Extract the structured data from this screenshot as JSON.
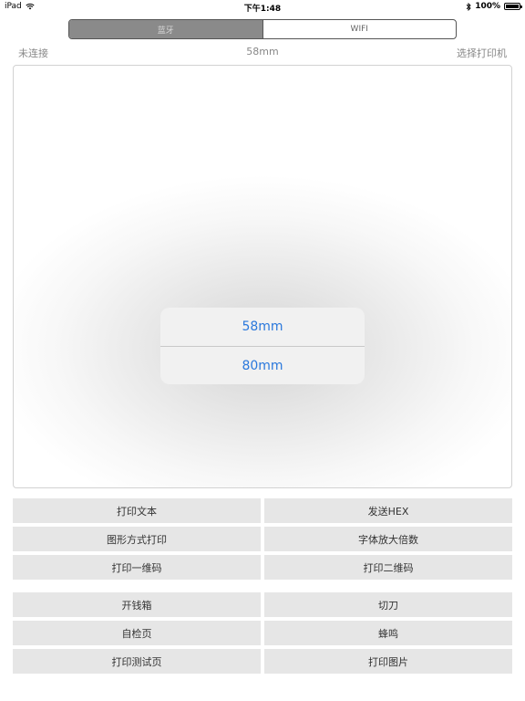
{
  "status_bar": {
    "device": "iPad",
    "time": "下午1:48",
    "battery": "100%",
    "battery_level": 1.0
  },
  "tabs": {
    "bluetooth": "蓝牙",
    "wifi": "WIFI"
  },
  "info": {
    "connection": "未连接",
    "paper_size": "58mm",
    "select_printer": "选择打印机"
  },
  "popup": {
    "options": [
      "58mm",
      "80mm"
    ]
  },
  "buttons": {
    "group1": [
      "打印文本",
      "发送HEX",
      "图形方式打印",
      "字体放大倍数",
      "打印一维码",
      "打印二维码"
    ],
    "group2": [
      "开钱箱",
      "切刀",
      "自检页",
      "蜂鸣",
      "打印测试页",
      "打印图片"
    ]
  },
  "colors": {
    "accent": "#2a78dc",
    "segment_active": "#8a8a8a",
    "button_bg": "#e6e6e6"
  }
}
